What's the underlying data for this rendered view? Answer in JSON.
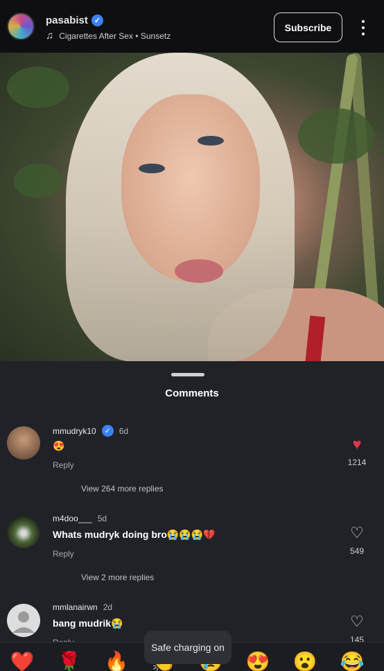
{
  "header": {
    "username": "pasabist",
    "music": "Cigarettes After Sex • Sunsetz",
    "subscribe_label": "Subscribe",
    "verified_mark": "✓"
  },
  "comments_title": "Comments",
  "comments": [
    {
      "user": "mmudryk10",
      "verified": true,
      "time": "6d",
      "text": "😍",
      "reply": "Reply",
      "more": "View 264 more replies",
      "likes": "1214",
      "liked": true
    },
    {
      "user": "m4doo___",
      "verified": false,
      "time": "5d",
      "text": "Whats mudryk doing bro😭😭😭💔",
      "reply": "Reply",
      "more": "View 2 more replies",
      "likes": "549",
      "liked": false
    },
    {
      "user": "mmlanairwn",
      "verified": false,
      "time": "2d",
      "text": "bang mudrik😭",
      "reply": "Reply",
      "likes": "145",
      "liked": false
    }
  ],
  "emoji_bar": [
    "❤️",
    "🌹",
    "🔥",
    "👏",
    "😢",
    "😍",
    "😮",
    "😂"
  ],
  "toast": "Safe charging on",
  "icons": {
    "music": "music-note-icon",
    "verified": "verified-badge-icon",
    "more": "more-vertical-icon",
    "heart": "heart-icon"
  },
  "colors": {
    "panel": "#212228",
    "like": "#e8344c",
    "verified": "#3b82f6"
  }
}
